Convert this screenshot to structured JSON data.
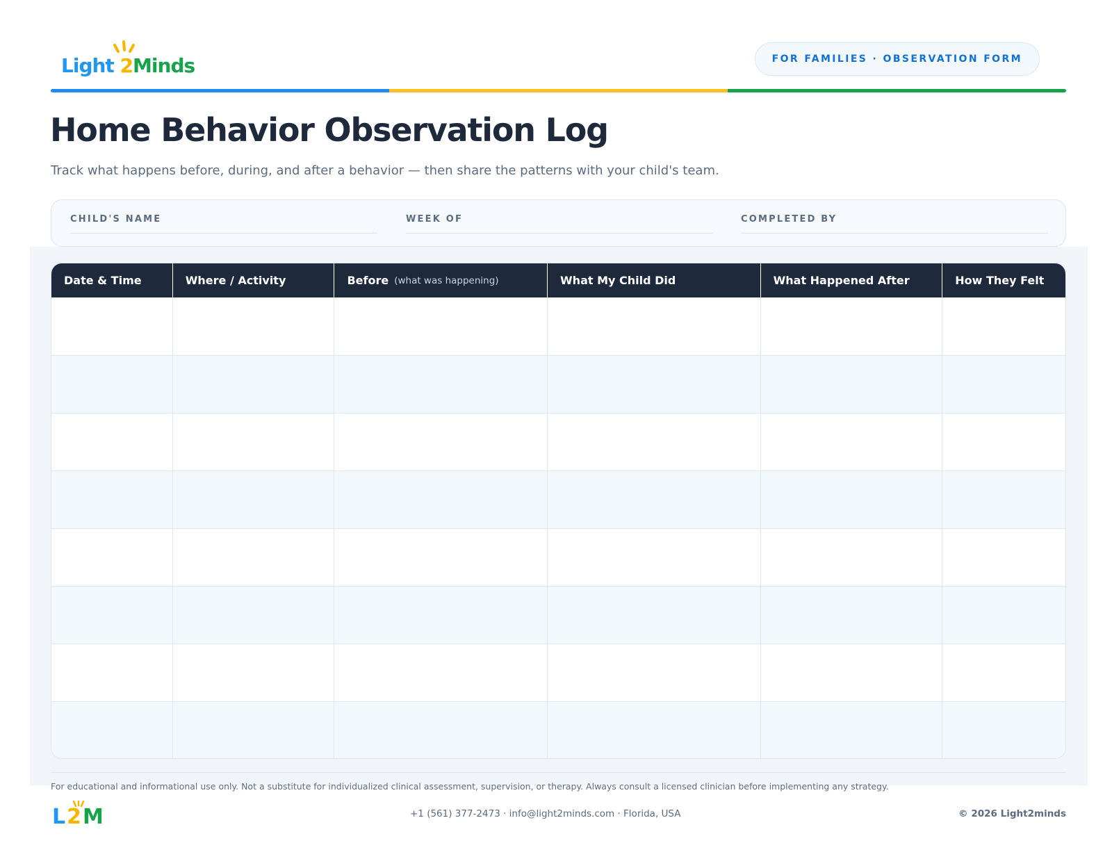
{
  "brand": {
    "logo_part1": "Light",
    "logo_part2": "2",
    "logo_part3": "Minds",
    "mini_l": "L",
    "mini_2": "2",
    "mini_m": "M",
    "colors": {
      "blue": "#1e88f5",
      "yellow": "#f7b500",
      "green": "#16a34a",
      "navy": "#1e293b"
    }
  },
  "header": {
    "tag": "FOR FAMILIES · OBSERVATION FORM"
  },
  "title": "Home Behavior Observation Log",
  "subtitle": "Track what happens before, during, and after a behavior — then share the patterns with your child's team.",
  "info_fields": [
    {
      "label": "CHILD'S NAME",
      "value": ""
    },
    {
      "label": "WEEK OF",
      "value": ""
    },
    {
      "label": "COMPLETED BY",
      "value": ""
    }
  ],
  "table": {
    "columns": [
      {
        "label": "Date & Time",
        "hint": ""
      },
      {
        "label": "Where / Activity",
        "hint": ""
      },
      {
        "label": "Before",
        "hint": "(what was happening)"
      },
      {
        "label": "What My Child Did",
        "hint": ""
      },
      {
        "label": "What Happened After",
        "hint": ""
      },
      {
        "label": "How They Felt",
        "hint": ""
      }
    ],
    "rows": [
      [
        "",
        "",
        "",
        "",
        "",
        ""
      ],
      [
        "",
        "",
        "",
        "",
        "",
        ""
      ],
      [
        "",
        "",
        "",
        "",
        "",
        ""
      ],
      [
        "",
        "",
        "",
        "",
        "",
        ""
      ],
      [
        "",
        "",
        "",
        "",
        "",
        ""
      ],
      [
        "",
        "",
        "",
        "",
        "",
        ""
      ],
      [
        "",
        "",
        "",
        "",
        "",
        ""
      ],
      [
        "",
        "",
        "",
        "",
        "",
        ""
      ]
    ]
  },
  "footer": {
    "disclaimer": "For educational and informational use only. Not a substitute for individualized clinical assessment, supervision, or therapy. Always consult a licensed clinician before implementing any strategy.",
    "contact": "+1 (561) 377-2473 · info@light2minds.com · Florida, USA",
    "copyright": "© 2026 Light2minds"
  }
}
